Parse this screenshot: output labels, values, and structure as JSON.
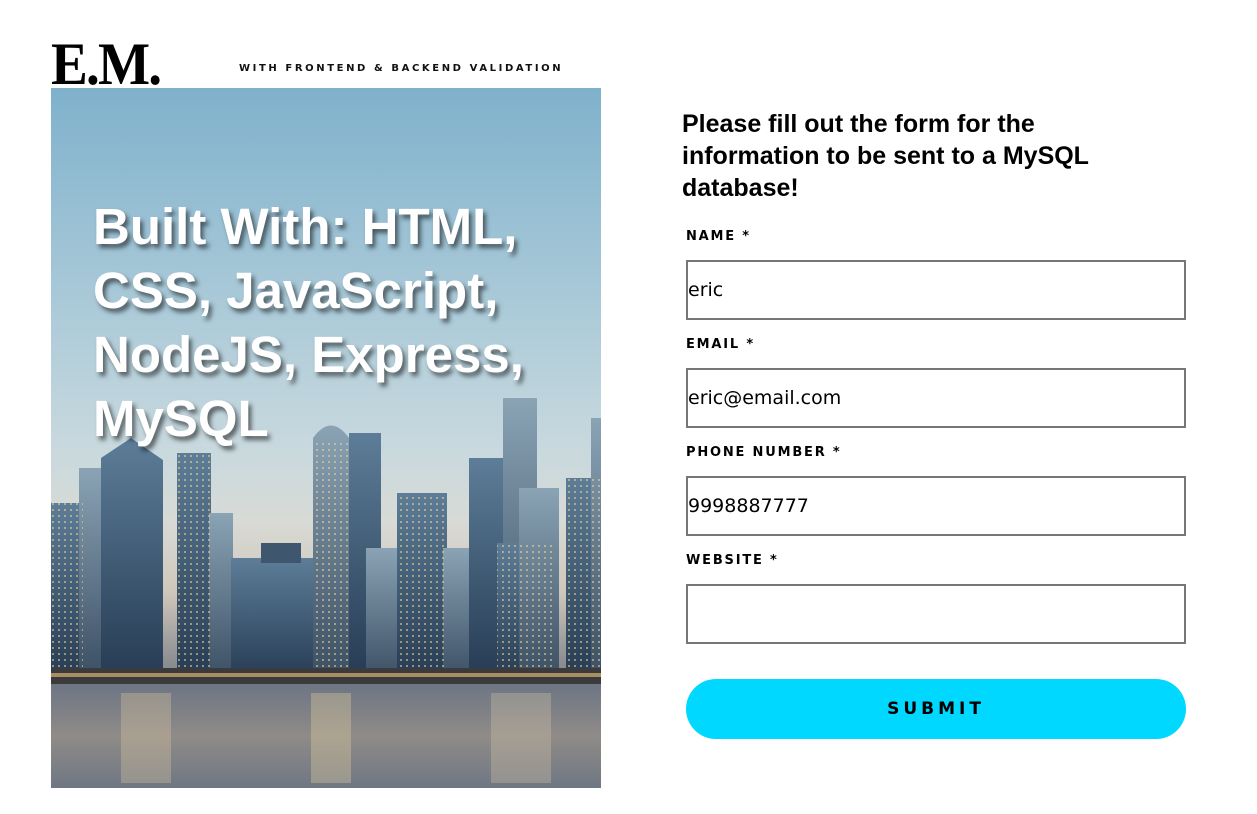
{
  "header": {
    "logo": "E.M.",
    "tagline": "WITH FRONTEND & BACKEND VALIDATION"
  },
  "hero": {
    "text": "Built With: HTML, CSS, JavaScript, NodeJS, Express, MySQL",
    "image": "city-skyline-at-dusk"
  },
  "form": {
    "heading": "Please fill out the form for the information to be sent to a MySQL database!",
    "fields": [
      {
        "label": "NAME *",
        "value": "eric"
      },
      {
        "label": "EMAIL *",
        "value": "eric@email.com"
      },
      {
        "label": "PHONE NUMBER *",
        "value": "9998887777"
      },
      {
        "label": "WEBSITE *",
        "value": ""
      }
    ],
    "submit_label": "SUBMIT"
  },
  "colors": {
    "accent": "#00d8ff",
    "input_border": "#767676"
  }
}
